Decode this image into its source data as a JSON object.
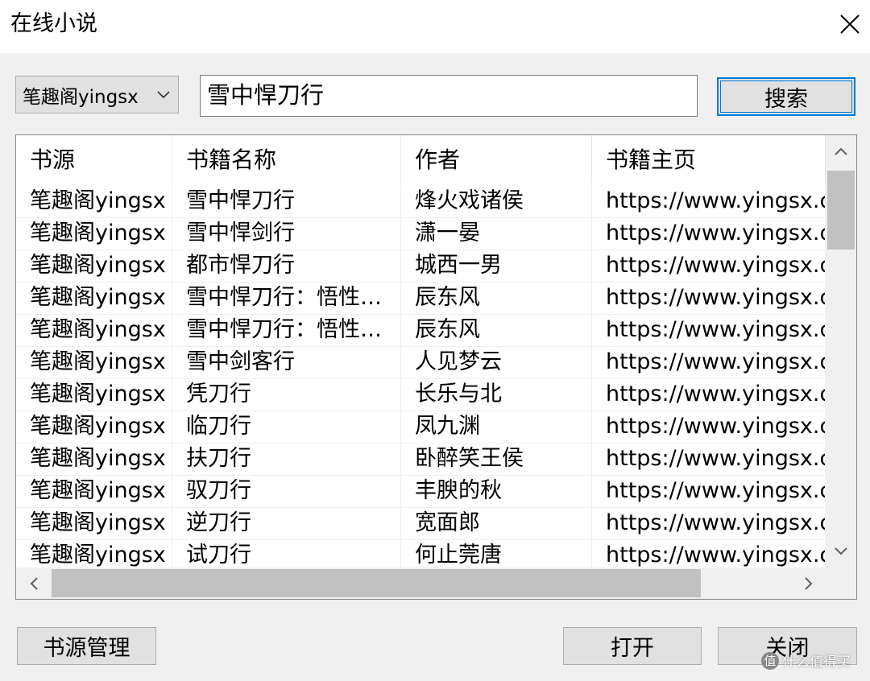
{
  "window": {
    "title": "在线小说"
  },
  "toolbar": {
    "source_selected": "笔趣阁yingsx",
    "search_value": "雪中悍刀行",
    "search_label": "搜索"
  },
  "table": {
    "columns": [
      "书源",
      "书籍名称",
      "作者",
      "书籍主页"
    ],
    "rows": [
      {
        "source": "笔趣阁yingsx",
        "name": "雪中悍刀行",
        "author": "烽火戏诸侯",
        "url": "https://www.yingsx.com"
      },
      {
        "source": "笔趣阁yingsx",
        "name": "雪中悍剑行",
        "author": "潇一晏",
        "url": "https://www.yingsx.com"
      },
      {
        "source": "笔趣阁yingsx",
        "name": "都市悍刀行",
        "author": "城西一男",
        "url": "https://www.yingsx.com"
      },
      {
        "source": "笔趣阁yingsx",
        "name": "雪中悍刀行：悟性…",
        "author": "辰东风",
        "url": "https://www.yingsx.com"
      },
      {
        "source": "笔趣阁yingsx",
        "name": "雪中悍刀行：悟性…",
        "author": "辰东风",
        "url": "https://www.yingsx.com"
      },
      {
        "source": "笔趣阁yingsx",
        "name": "雪中剑客行",
        "author": "人见梦云",
        "url": "https://www.yingsx.com"
      },
      {
        "source": "笔趣阁yingsx",
        "name": "凭刀行",
        "author": "长乐与北",
        "url": "https://www.yingsx.com"
      },
      {
        "source": "笔趣阁yingsx",
        "name": "临刀行",
        "author": "凤九渊",
        "url": "https://www.yingsx.com"
      },
      {
        "source": "笔趣阁yingsx",
        "name": "扶刀行",
        "author": "卧醉笑王侯",
        "url": "https://www.yingsx.com"
      },
      {
        "source": "笔趣阁yingsx",
        "name": "驭刀行",
        "author": "丰腴的秋",
        "url": "https://www.yingsx.com"
      },
      {
        "source": "笔趣阁yingsx",
        "name": "逆刀行",
        "author": "宽面郎",
        "url": "https://www.yingsx.com"
      },
      {
        "source": "笔趣阁yingsx",
        "name": "试刀行",
        "author": "何止莞唐",
        "url": "https://www.yingsx.com"
      }
    ]
  },
  "buttons": {
    "source_manage": "书源管理",
    "open": "打开",
    "close": "关闭"
  },
  "watermark": {
    "text": "什么值得买",
    "icon_glyph": "值"
  }
}
